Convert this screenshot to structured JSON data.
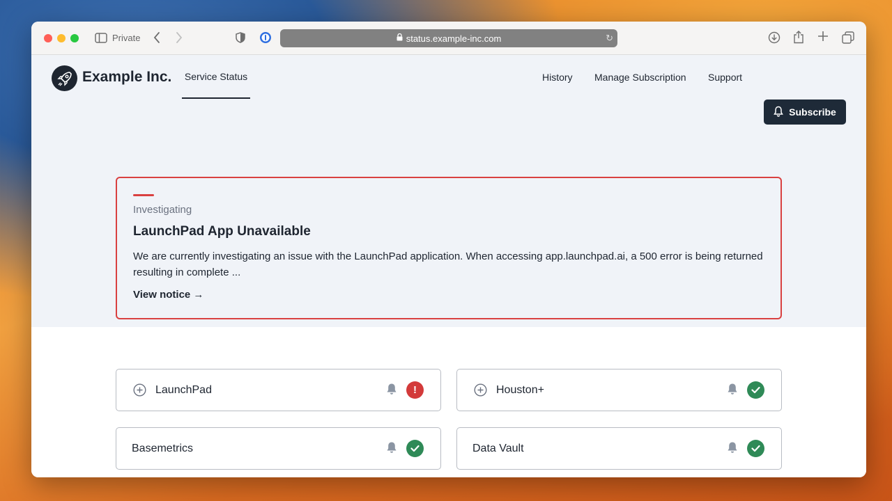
{
  "browser": {
    "private_label": "Private",
    "url": "status.example-inc.com"
  },
  "site": {
    "brand": "Example Inc.",
    "nav": {
      "active": "Service Status",
      "history": "History",
      "manage": "Manage Subscription",
      "support": "Support",
      "subscribe": "Subscribe"
    }
  },
  "notice": {
    "state": "Investigating",
    "title": "LaunchPad App Unavailable",
    "description": "We are currently investigating an issue with the LaunchPad application. When accessing app.launchpad.ai, a 500 error is being returned resulting in complete ...",
    "link": "View notice →",
    "accent_color": "#d94040"
  },
  "services": [
    {
      "name": "LaunchPad",
      "expandable": true,
      "status": "error",
      "status_icon": "exclamation-icon"
    },
    {
      "name": "Houston+",
      "expandable": true,
      "status": "operational",
      "status_icon": "check-icon"
    },
    {
      "name": "Basemetrics",
      "expandable": false,
      "status": "operational",
      "status_icon": "check-icon"
    },
    {
      "name": "Data Vault",
      "expandable": false,
      "status": "operational",
      "status_icon": "check-icon"
    }
  ],
  "colors": {
    "operational": "#2f8a57",
    "error": "#d33a3a",
    "brand_dark": "#1e2a38"
  }
}
